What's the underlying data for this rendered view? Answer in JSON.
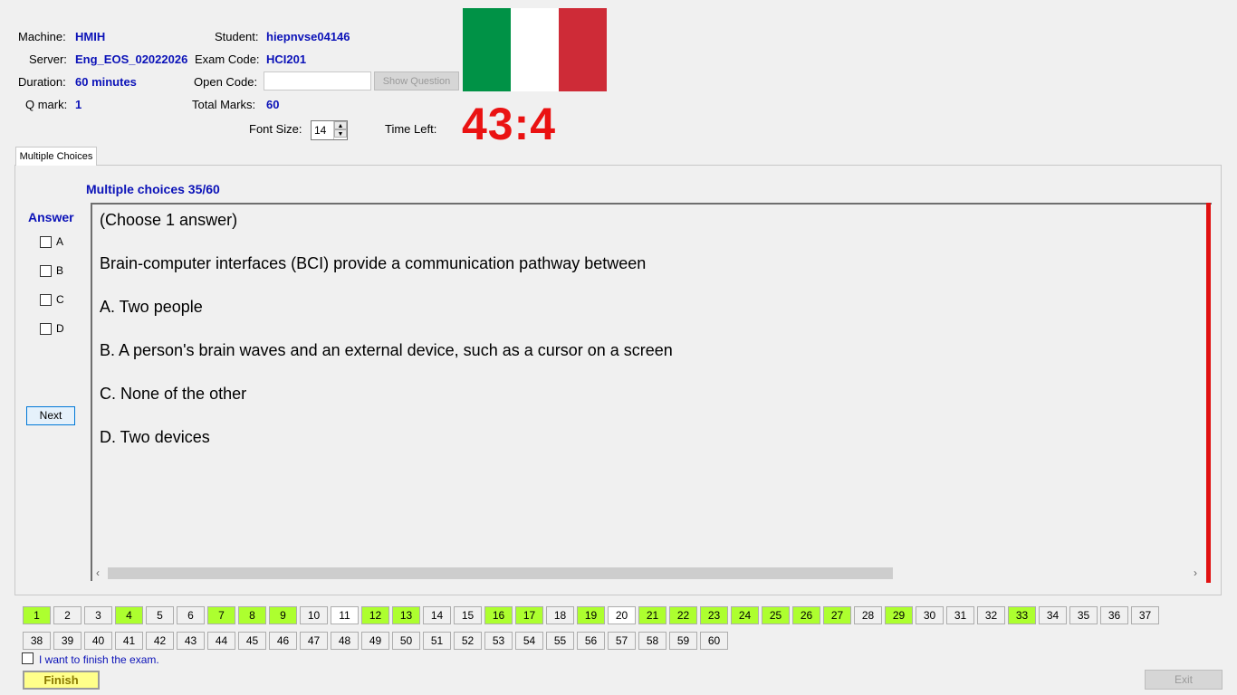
{
  "info": {
    "machine_label": "Machine:",
    "machine": "HMIH",
    "server_label": "Server:",
    "server": "Eng_EOS_02022026",
    "duration_label": "Duration:",
    "duration": "60 minutes",
    "qmark_label": "Q mark:",
    "qmark": "1",
    "student_label": "Student:",
    "student": "hiepnvse04146",
    "exam_code_label": "Exam Code:",
    "exam_code": "HCI201",
    "open_code_label": "Open Code:",
    "open_code": "",
    "show_question": "Show Question",
    "total_marks_label": "Total Marks:",
    "total_marks": "60",
    "font_size_label": "Font Size:",
    "font_size": "14",
    "time_left_label": "Time Left:",
    "time_left": "43:4"
  },
  "flag": {
    "colors": [
      "#009246",
      "#ffffff",
      "#ce2b37"
    ]
  },
  "tab": {
    "label": "Multiple Choices"
  },
  "question": {
    "counter": "Multiple choices 35/60",
    "answer_label": "Answer",
    "options": [
      "A",
      "B",
      "C",
      "D"
    ],
    "next_label": "Next",
    "lines": [
      "(Choose 1 answer)",
      "Brain-computer interfaces (BCI) provide a communication pathway between",
      "A.  Two people",
      "B.  A person's brain waves and an external device, such as a cursor on a screen",
      "C.  None of the other",
      "D.  Two devices"
    ]
  },
  "nav": {
    "row1": [
      "1",
      "2",
      "3",
      "4",
      "5",
      "6",
      "7",
      "8",
      "9",
      "10",
      "11",
      "12",
      "13",
      "14",
      "15",
      "16",
      "17",
      "18",
      "19",
      "20",
      "21",
      "22",
      "23",
      "24",
      "25",
      "26",
      "27",
      "28",
      "29",
      "30",
      "31",
      "32",
      "33",
      "34",
      "35",
      "36",
      "37"
    ],
    "row2": [
      "38",
      "39",
      "40",
      "41",
      "42",
      "43",
      "44",
      "45",
      "46",
      "47",
      "48",
      "49",
      "50",
      "51",
      "52",
      "53",
      "54",
      "55",
      "56",
      "57",
      "58",
      "59",
      "60"
    ],
    "answered": [
      "1",
      "4",
      "7",
      "8",
      "9",
      "12",
      "13",
      "16",
      "17",
      "19",
      "21",
      "22",
      "23",
      "24",
      "25",
      "26",
      "27",
      "29",
      "33"
    ],
    "highlighted": [
      "11",
      "20"
    ]
  },
  "footer": {
    "finish_check_label": "I want to finish the exam.",
    "finish_label": "Finish",
    "exit_label": "Exit"
  }
}
